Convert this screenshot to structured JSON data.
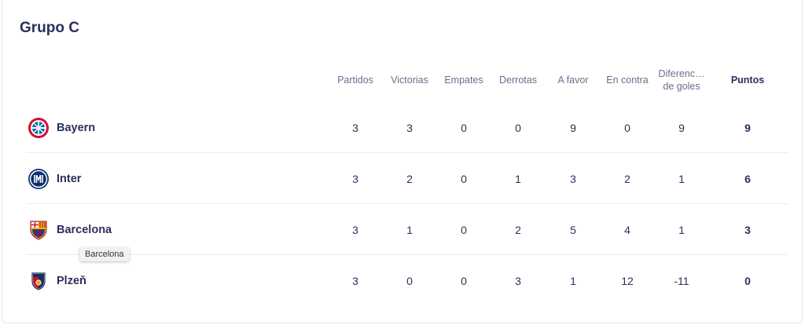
{
  "group": {
    "title": "Grupo C"
  },
  "columns": [
    {
      "key": "played",
      "label": "Partidos"
    },
    {
      "key": "wins",
      "label": "Victorias"
    },
    {
      "key": "draws",
      "label": "Empates"
    },
    {
      "key": "losses",
      "label": "Derrotas"
    },
    {
      "key": "gf",
      "label": "A favor"
    },
    {
      "key": "ga",
      "label": "En contra"
    },
    {
      "key": "gd",
      "label": "Diferenc… de goles"
    },
    {
      "key": "pts",
      "label": "Puntos"
    }
  ],
  "rows": [
    {
      "team": "Bayern",
      "crest": "bayern-crest-icon",
      "values": [
        "3",
        "3",
        "0",
        "0",
        "9",
        "0",
        "9",
        "9"
      ]
    },
    {
      "team": "Inter",
      "crest": "inter-crest-icon",
      "values": [
        "3",
        "2",
        "0",
        "1",
        "3",
        "2",
        "1",
        "6"
      ]
    },
    {
      "team": "Barcelona",
      "crest": "barcelona-crest-icon",
      "values": [
        "3",
        "1",
        "0",
        "2",
        "5",
        "4",
        "1",
        "3"
      ]
    },
    {
      "team": "Plzeň",
      "crest": "plzen-crest-icon",
      "values": [
        "3",
        "0",
        "0",
        "3",
        "1",
        "12",
        "-11",
        "0"
      ]
    }
  ],
  "tooltip": {
    "text": "Barcelona"
  },
  "colors": {
    "text": "#2c2f5e",
    "muted": "#6b6e8c",
    "separator": "#ececf1",
    "bayern_red": "#dc052d",
    "bayern_blue": "#0066b2",
    "inter_blue": "#0d2f6e",
    "barca_blue": "#004d98",
    "barca_red": "#a50044",
    "plzen_red": "#c8102e",
    "plzen_blue": "#1b2b5c"
  }
}
